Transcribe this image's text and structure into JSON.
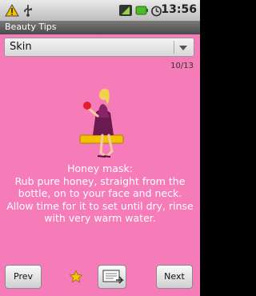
{
  "status_bar": {
    "time": "13:56",
    "icons": [
      "warning-icon",
      "usb-icon",
      "signal-icon",
      "battery-icon",
      "alarm-icon"
    ]
  },
  "app": {
    "title": "Beauty Tips"
  },
  "category_spinner": {
    "selected": "Skin"
  },
  "counter": "10/13",
  "tip": {
    "title": "Honey mask:",
    "body": "Rub pure honey, straight from the bottle, on to your face and neck. Allow time for it to set until dry, rinse with very warm water."
  },
  "buttons": {
    "prev": "Prev",
    "next": "Next"
  },
  "colors": {
    "background": "#f57cb8",
    "text": "#ffffff",
    "star": "#f5c400"
  }
}
